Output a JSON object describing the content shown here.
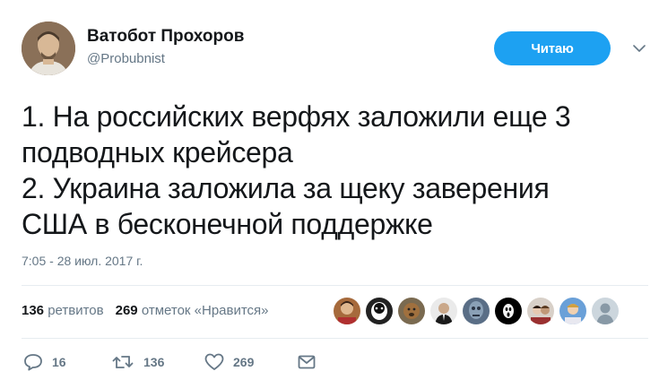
{
  "tweet": {
    "author": {
      "display_name": "Ватобот Прохоров",
      "handle": "@Probubnist"
    },
    "follow_button_label": "Читаю",
    "text_lines": [
      "1. На российских верфях заложили еще 3",
      "подводных крейсера",
      "2. Украина заложила за щеку заверения",
      "США в бесконечной поддержке"
    ],
    "timestamp": "7:05 - 28 июл. 2017 г."
  },
  "stats": {
    "retweets_count": "136",
    "retweets_label": "ретвитов",
    "likes_count": "269",
    "likes_label": "отметок «Нравится»"
  },
  "actions": {
    "reply_count": "16",
    "retweet_count": "136",
    "like_count": "269"
  },
  "colors": {
    "accent": "#1da1f2",
    "muted": "#657786",
    "text": "#14171a",
    "divider": "#e6ecf0"
  },
  "icons": [
    "chevron-down-icon",
    "reply-icon",
    "retweet-icon",
    "heart-icon",
    "direct-message-icon"
  ]
}
